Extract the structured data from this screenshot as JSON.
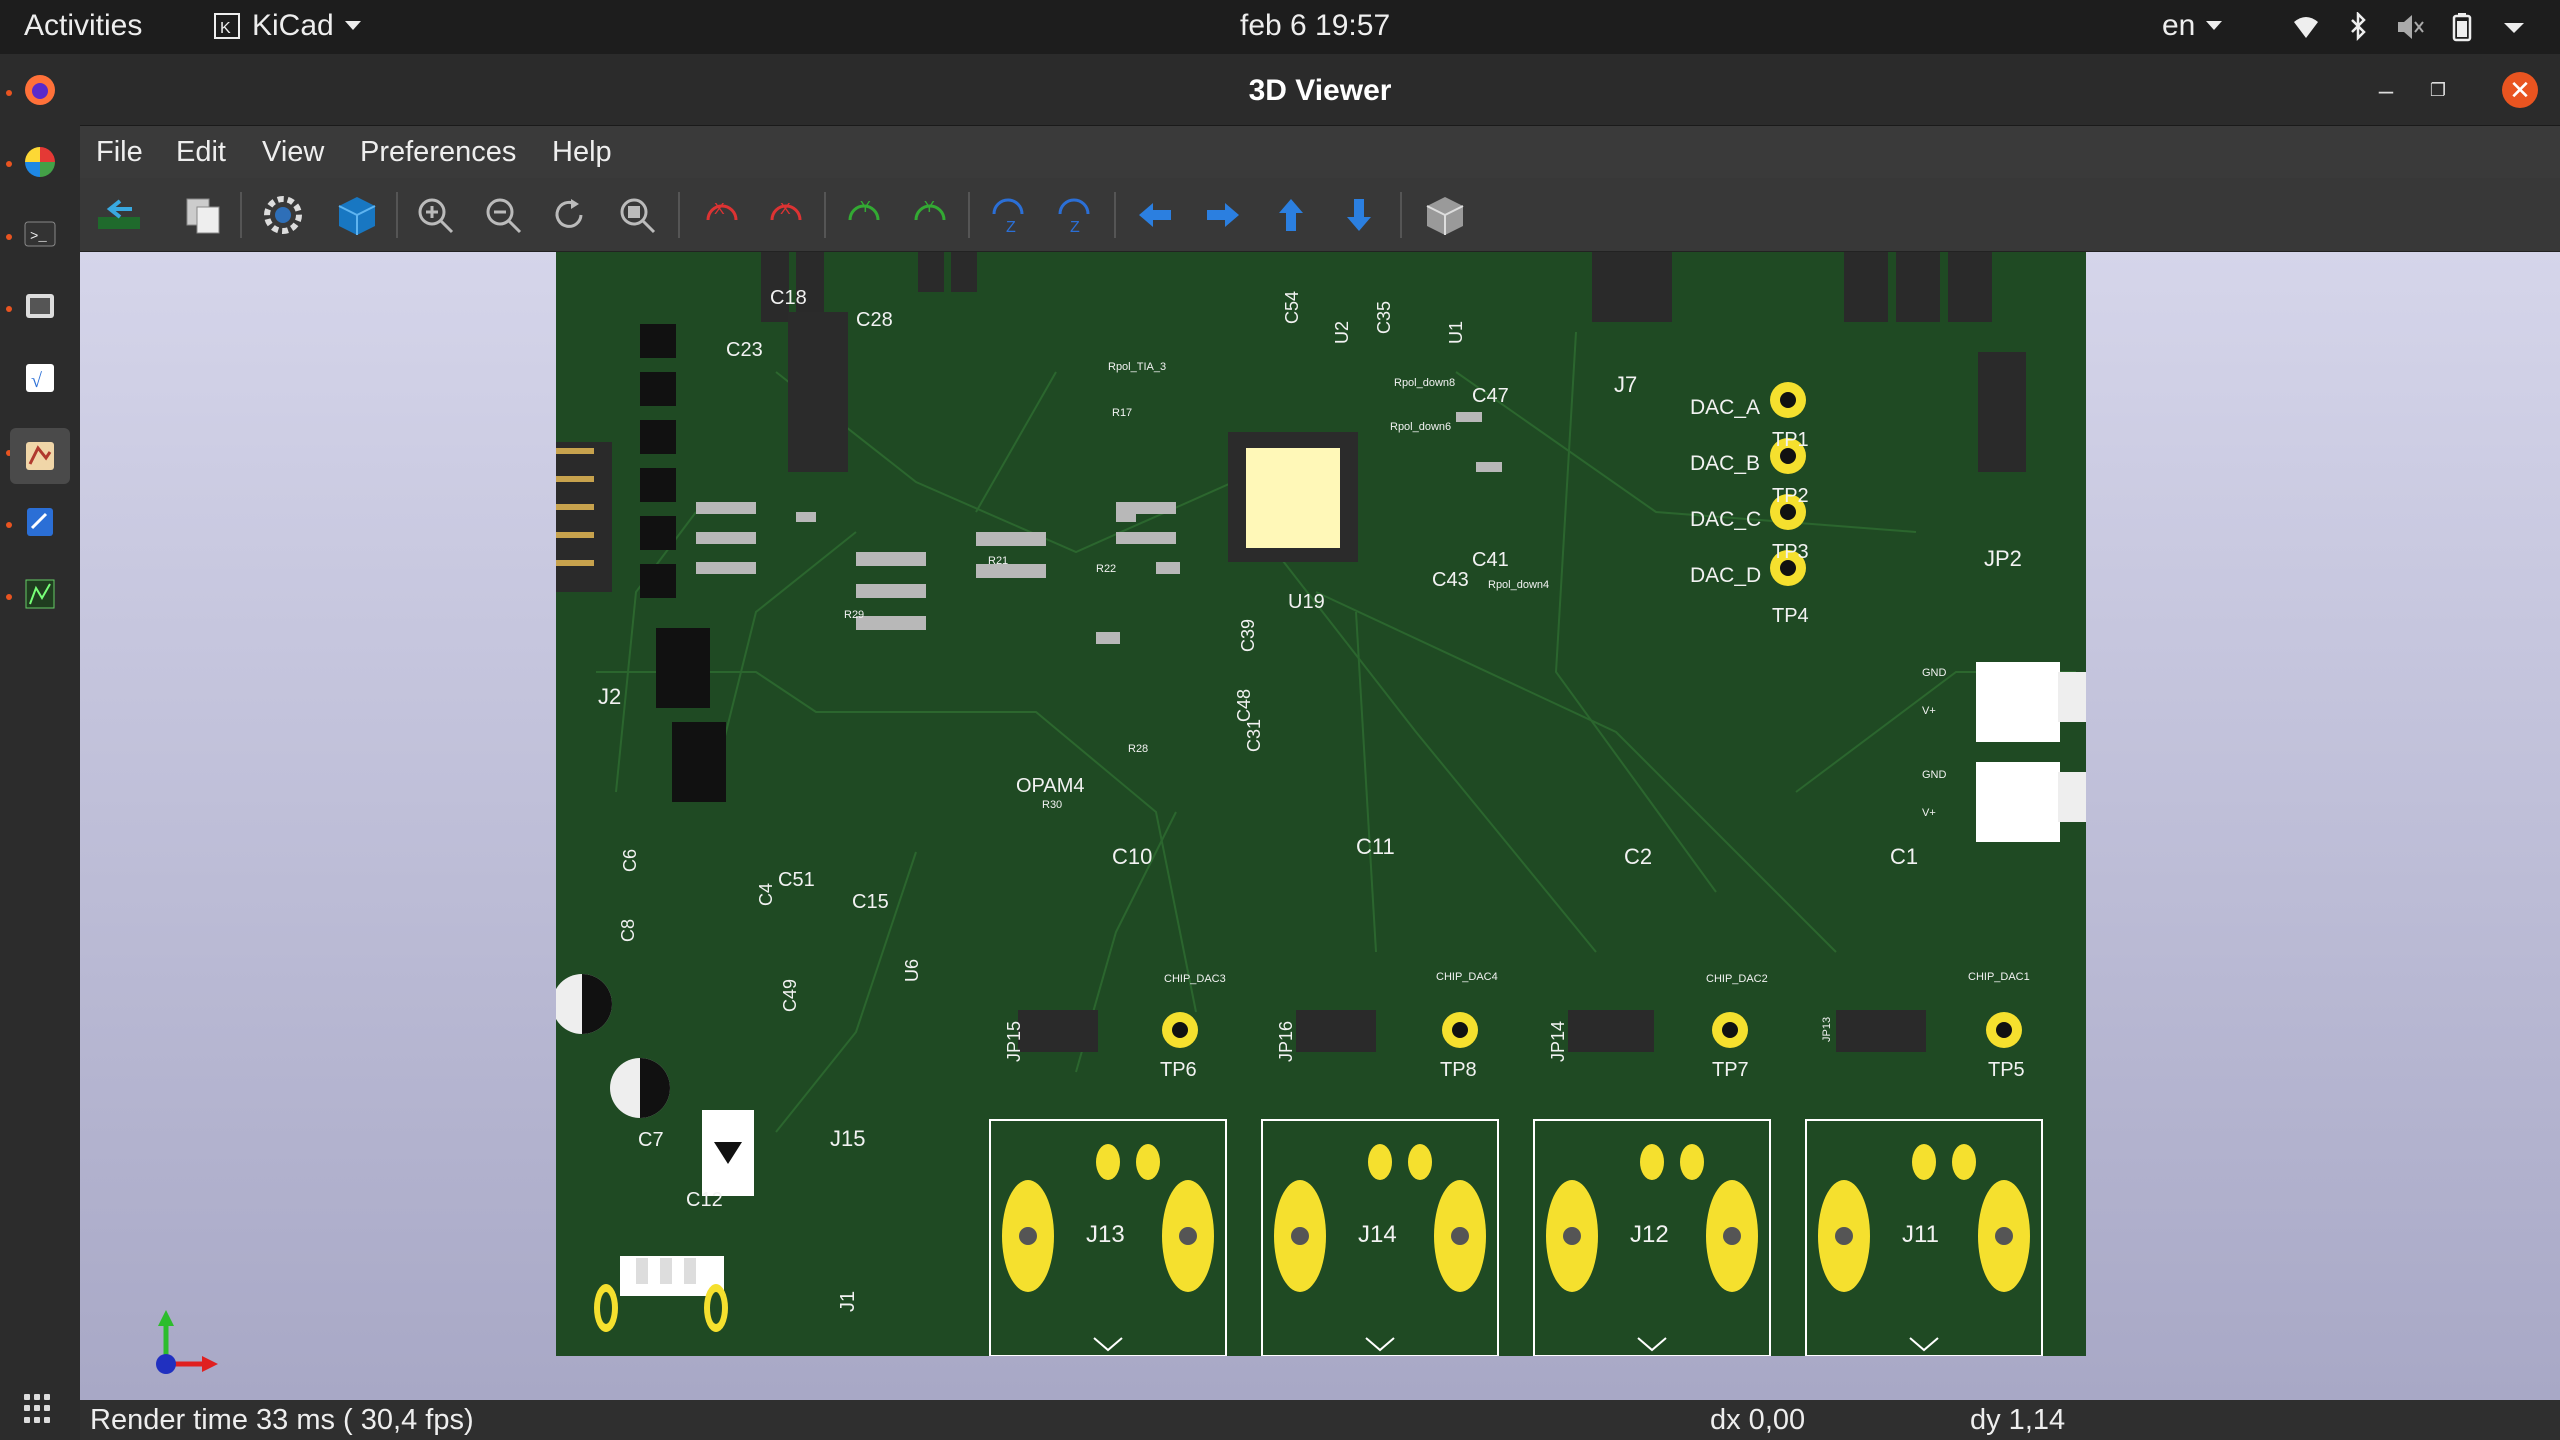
{
  "topbar": {
    "activities": "Activities",
    "app": "KiCad",
    "clock": "feb 6  19:57",
    "lang": "en"
  },
  "window": {
    "title": "3D Viewer",
    "menu": [
      "File",
      "Edit",
      "View",
      "Preferences",
      "Help"
    ]
  },
  "board_labels": {
    "connectors": [
      "J2",
      "J7",
      "JP2",
      "J15",
      "J1",
      "J13",
      "J14",
      "J12",
      "J11"
    ],
    "testpoints": [
      "TP1",
      "TP2",
      "TP3",
      "TP4",
      "TP5",
      "TP6",
      "TP7",
      "TP8"
    ],
    "dac": [
      "DAC_A",
      "DAC_B",
      "DAC_C",
      "DAC_D"
    ],
    "chip_dac": [
      "CHIP_DAC3",
      "CHIP_DAC4",
      "CHIP_DAC2",
      "CHIP_DAC1"
    ],
    "jumpers": [
      "JP15",
      "JP16",
      "JP14",
      "JP13"
    ],
    "caps": [
      "C10",
      "C11",
      "C2",
      "C1",
      "C47",
      "C41",
      "C43",
      "C35",
      "C54",
      "C18",
      "C23",
      "C28",
      "C8",
      "C6",
      "C4",
      "C51",
      "C15",
      "C49",
      "C7",
      "C12",
      "C39",
      "C48",
      "C31"
    ],
    "ics": [
      "U1",
      "U2",
      "U6",
      "U19"
    ],
    "misc": [
      "R17",
      "R21",
      "R22",
      "R28",
      "R29",
      "R30",
      "OPAM4",
      "Rpol_TIA_3",
      "Rpol_down8",
      "Rpol_down6",
      "Rpol_down4",
      "GND",
      "V+"
    ]
  },
  "status": {
    "render": "Render time 33 ms ( 30,4 fps)",
    "dx": "dx 0,00",
    "dy": "dy 1,14"
  }
}
